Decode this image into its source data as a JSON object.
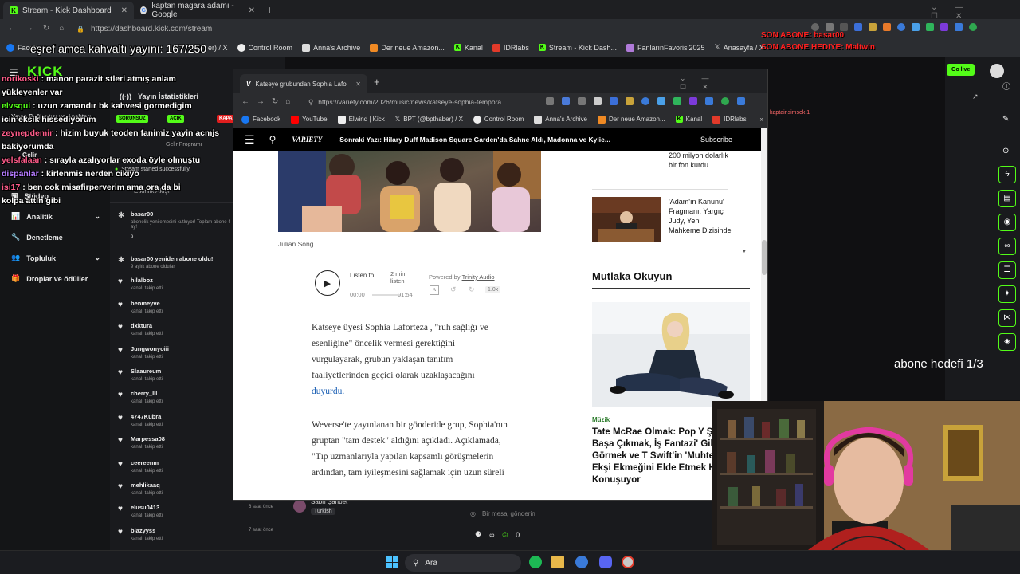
{
  "outer_browser": {
    "tabs": [
      {
        "title": "Stream - Kick Dashboard",
        "active": true
      },
      {
        "title": "kaptan magara adamı - Google",
        "active": false
      }
    ],
    "url": "https://dashboard.kick.com/stream",
    "bookmarks": [
      "Faceb",
      "Control Room",
      "Anna's Archive",
      "Der neue Amazon...",
      "Kanal",
      "IDRlabs",
      "Stream - Kick Dash...",
      "FanlarınFavorisi2025",
      "Anasayfa / X"
    ],
    "bookmark_partial": "er) / X"
  },
  "overlay": {
    "counter_text": "eşref amca kahvaltı yayını: 167/250",
    "son_abone": "SON ABONE: basar00",
    "son_abone_hediye": "SON ABONE HEDIYE: Maltwin",
    "goal_text": "abone hedefi 1/3",
    "chat": [
      {
        "user": "norikoski",
        "msg": "manon parazit stleri atmış anlam",
        "color": "#ff5c8a"
      },
      {
        "user": "",
        "msg": "yükleyenler var",
        "color": "#ffffff"
      },
      {
        "user": "elvsqui",
        "msg": "uzun zamandır bk kahvesi gormedigim",
        "color": "#53fc18"
      },
      {
        "user": "",
        "msg": "icin eksik hissediyorum",
        "color": "#ffffff"
      },
      {
        "user": "zeynepdemir",
        "msg": "hizim buyuk teoden fanimiz yayin acmjs",
        "color": "#ff5c8a"
      },
      {
        "user": "",
        "msg": "bakiyorumda",
        "color": "#ffffff"
      },
      {
        "user": "yelsfalaan",
        "msg": "sırayla azalıyorlar exoda öyle olmuştu",
        "color": "#ff5c8a"
      },
      {
        "user": "dispanlar",
        "msg": "kirlenmis nerden cikiyo",
        "color": "#b57bff"
      },
      {
        "user": "isi17",
        "msg": "ben cok misafirperverim ama ora da bi",
        "color": "#ff5c8a"
      },
      {
        "user": "",
        "msg": "kolpa attın gibi",
        "color": "#ffffff"
      }
    ]
  },
  "kick": {
    "logo": "KICK",
    "sidebar": {
      "items": [
        {
          "label": "Yayın Bağlantısı ve Anahtarı"
        },
        {
          "label": "Gelir"
        },
        {
          "label": "Stüdyo"
        },
        {
          "label": "Analitik"
        },
        {
          "label": "Denetleme"
        },
        {
          "label": "Topluluk"
        },
        {
          "label": "Droplar ve ödüller"
        }
      ]
    },
    "stats_title": "Yayın İstatistikleri",
    "badges": [
      "SORUNSUZ",
      "AÇIK",
      "KAPA"
    ],
    "gelir_programi": "Gelir Programı",
    "status_msg": "Stream started successfully.",
    "events_title": "Etkinlik Akışı",
    "events": [
      {
        "name": "basar00",
        "sub": "abonelik yenilemesini kutluyor! Toplam abone 4 ay!",
        "extra": "9"
      },
      {
        "name": "basar00 yeniden abone oldu!",
        "sub": "9 aylık abone oldular",
        "extra": ""
      },
      {
        "name": "hilalboz",
        "sub": "kanalı takip etti",
        "extra": ""
      },
      {
        "name": "benmeyve",
        "sub": "kanalı takip etti",
        "extra": ""
      },
      {
        "name": "dxktura",
        "sub": "kanalı takip etti",
        "extra": ""
      },
      {
        "name": "Jungwonyoiii",
        "sub": "kanalı takip etti",
        "extra": ""
      },
      {
        "name": "Slaaureum",
        "sub": "kanalı takip etti",
        "extra": ""
      },
      {
        "name": "cherry_lll",
        "sub": "kanalı takip etti",
        "extra": ""
      },
      {
        "name": "4747Kubra",
        "sub": "kanalı takip etti",
        "extra": ""
      },
      {
        "name": "Marpessa08",
        "sub": "kanalı takip etti",
        "extra": ""
      },
      {
        "name": "ceereenm",
        "sub": "kanalı takip etti",
        "extra": ""
      },
      {
        "name": "mehlikaaq",
        "sub": "kanalı takip etti",
        "extra": ""
      },
      {
        "name": "elusu0413",
        "sub": "kanalı takip etti",
        "time": "6 saat önce"
      },
      {
        "name": "blazyyss",
        "sub": "kanalı takip etti",
        "time": "7 saat önce"
      }
    ],
    "chat_input_placeholder": "Bir mesaj gönderin",
    "chat_counts": [
      "∞",
      "0"
    ],
    "go_live": "Go live",
    "user_mention": "kaptainsimsek 1",
    "bottom_user": "Sabri Şahbet",
    "bottom_lang": "Turkish"
  },
  "inner_browser": {
    "tab_title": "Katseye grubundan Sophia Lafo",
    "url": "https://variety.com/2026/music/news/katseye-sophia-tempora...",
    "bookmarks": [
      "Facebook",
      "YouTube",
      "Elwind | Kick",
      "BPT (@bpthaber) / X",
      "Control Room",
      "Anna's Archive",
      "Der neue Amazon...",
      "Kanal",
      "IDRlabs"
    ],
    "site_logo": "VARIETY",
    "next_story": "Sonraki Yazı: Hilary Duff Madison Square Garden'da Sahne Aldı, Madonna ve Kylie...",
    "subscribe": "Subscribe",
    "photo_credit": "Julian Song",
    "audio": {
      "listen": "Listen to ...",
      "duration": "2 min listen",
      "powered": "Powered by",
      "provider": "Trinity Audio",
      "time_start": "00:00",
      "time_end": "01:54",
      "speed": "1.0x"
    },
    "article_p1_a": "Katseye üyesi Sophia Laforteza , \"ruh sağlığı ve esenliğine\" öncelik vermesi gerektiğini vurgulayarak, grubun yaklaşan tanıtım faaliyetlerinden geçici olarak uzaklaşacağını",
    "article_p1_link": "duyurdu",
    "article_p1_end": ".",
    "article_p2": "Weverse'te yayınlanan bir gönderide grup, Sophia'nın gruptan \"tam destek\" aldığını açıkladı. Açıklamada, \"Tıp uzmanlarıyla yapılan kapsamlı görüşmelerin ardından, tam iyileşmesini sağlamak için uzun süreli",
    "sidebar_top_text": "200 milyon dolarlık bir fon kurdu.",
    "sidebar_item_text": "'Adam'ın Kanunu' Fragmanı: Yargıç Judy, Yeni Mahkeme Dizisinde",
    "must_read": "Mutlaka Okuyun",
    "feature_category": "Müzik",
    "feature_title": "Tate McRae Olmak: Pop Y Şöhretle Başa Çıkmak, İş Fantazi' Gibi Görmek ve T Swift'in 'Muhteşem' Ekşi Ekmeğini Elde Etmek Hak Konuşuyor"
  },
  "taskbar": {
    "search_label": "Ara"
  }
}
